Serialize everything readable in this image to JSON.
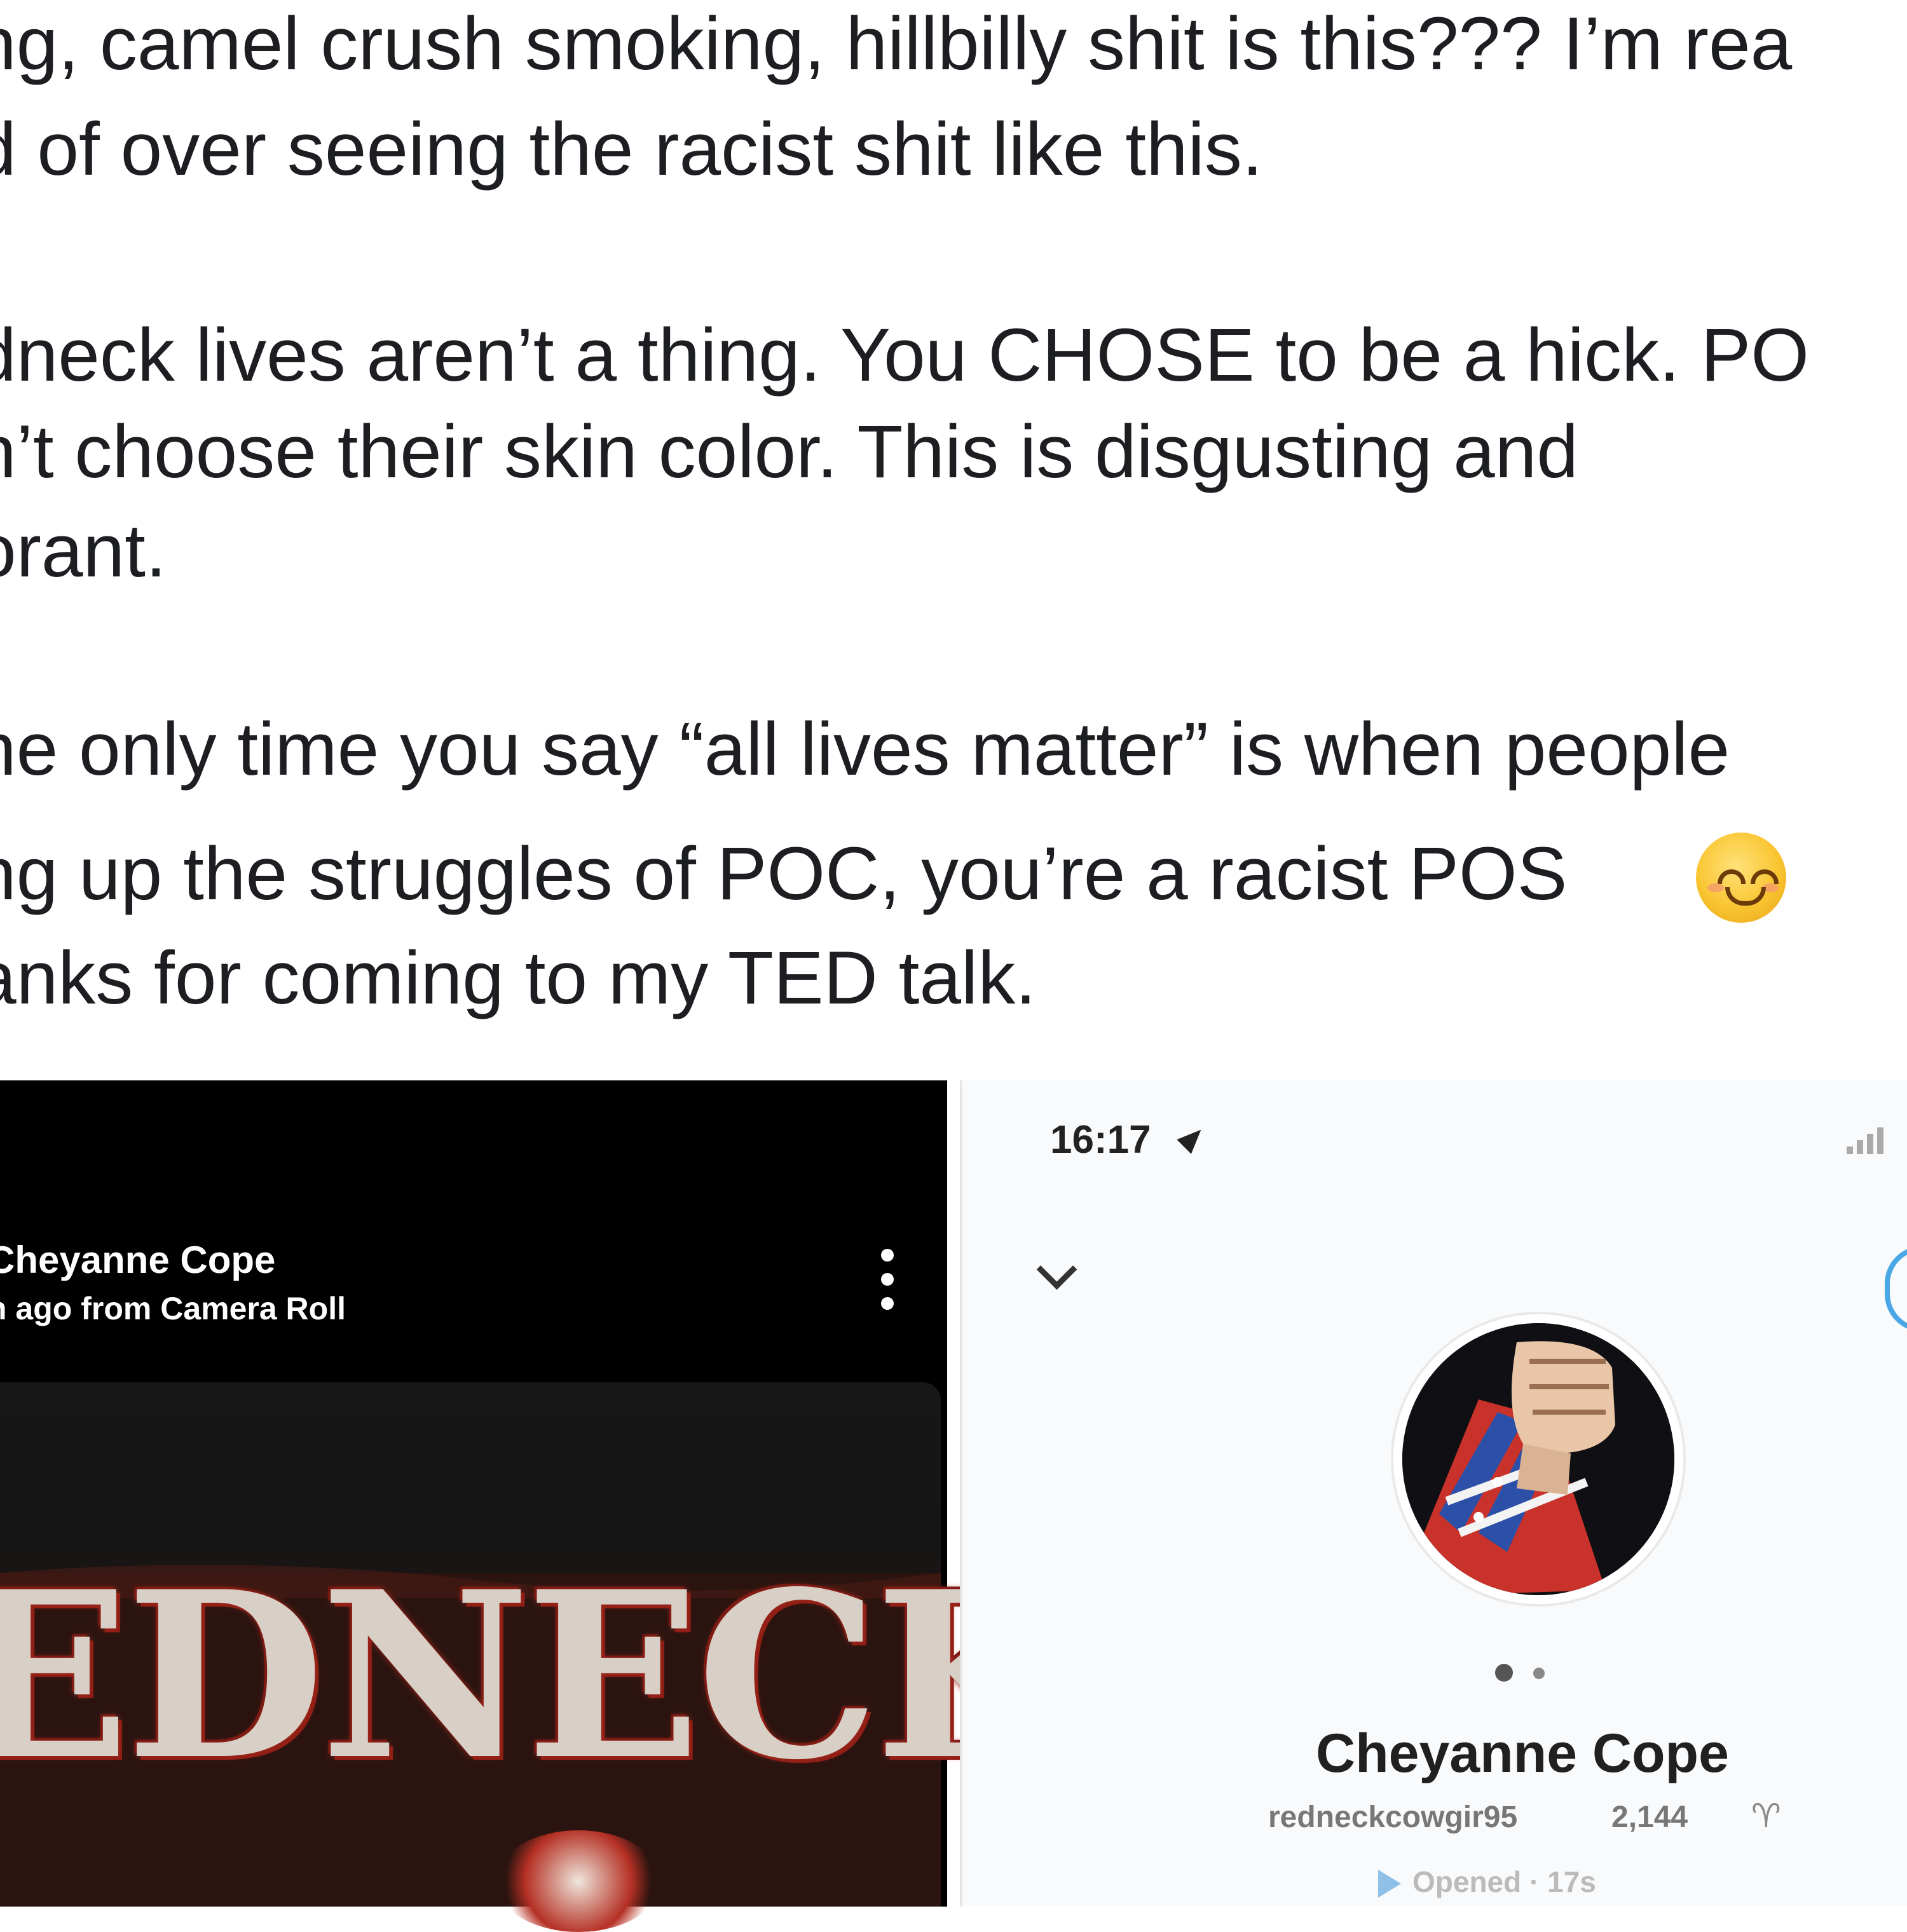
{
  "post": {
    "lines": [
      "ng, camel crush smoking, hillbilly shit is this??? I’m rea",
      "d of over seeing the racist shit like this.",
      "dneck lives aren’t a thing. You CHOSE to be a hick. PO",
      "n’t choose their skin color. This is disgusting and",
      "orant.",
      "ne only time you say “all lives matter” is when people",
      "ng up the struggles of POC, you’re a racist POS",
      "anks for coming to my TED talk."
    ],
    "emoji": "smiling-face-with-smiling-eyes"
  },
  "story": {
    "author": "Cheyanne Cope",
    "meta": "h ago from Camera Roll",
    "image_text": "EDNECK",
    "menu_icon": "more-vertical-icon"
  },
  "profile": {
    "time": "16:17",
    "display_name": "Cheyanne Cope",
    "username": "redneckcowgir95",
    "score": "2,144",
    "zodiac": "♈",
    "status": "Opened · 17s",
    "colors": {
      "opened_arrow": "#8fc0e8",
      "ring": "#4aa8e6"
    }
  }
}
